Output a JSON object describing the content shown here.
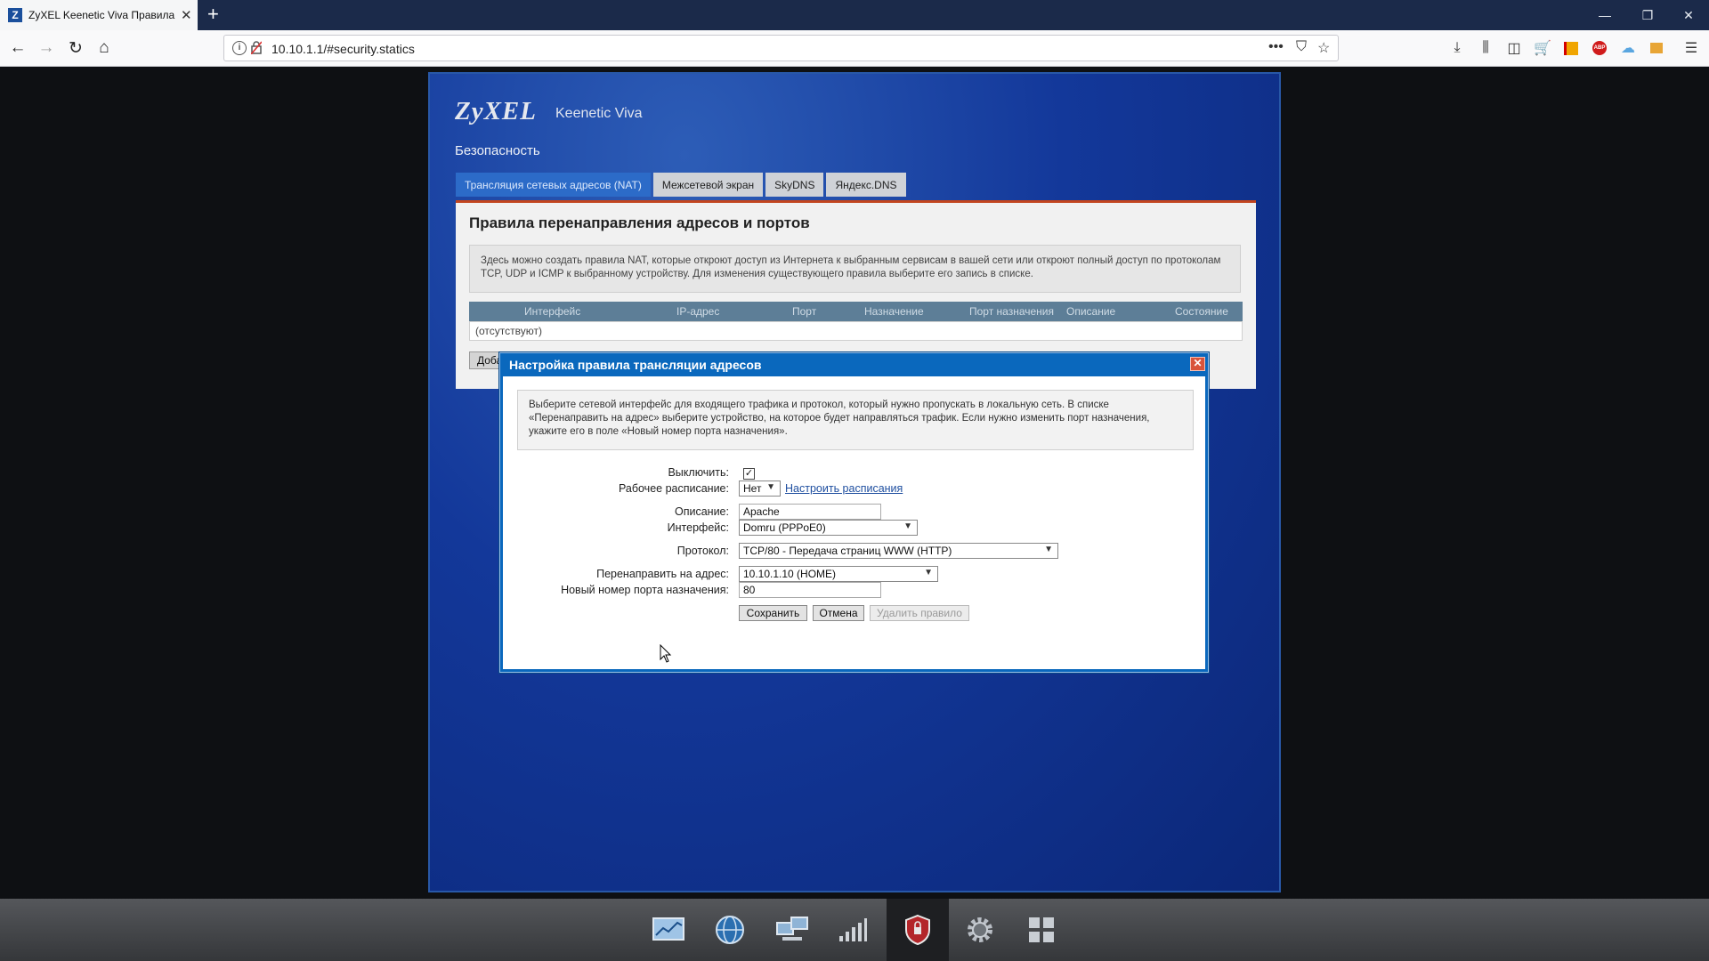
{
  "browser": {
    "tab_title": "ZyXEL Keenetic Viva Правила п",
    "favicon_letter": "Z",
    "url": "10.10.1.1/#security.statics"
  },
  "router": {
    "logo": "ZyXEL",
    "model": "Keenetic Viva",
    "section": "Безопасность",
    "tabs": [
      {
        "label": "Трансляция сетевых адресов (NAT)",
        "active": true
      },
      {
        "label": "Межсетевой экран",
        "active": false
      },
      {
        "label": "SkyDNS",
        "active": false
      },
      {
        "label": "Яндекс.DNS",
        "active": false
      }
    ],
    "panel_title": "Правила перенаправления адресов и портов",
    "panel_info": "Здесь можно создать правила NAT, которые откроют доступ из Интернета к выбранным сервисам в вашей сети или откроют полный доступ по протоколам TCP, UDP и ICMP к выбранному устройству. Для изменения существующего правила выберите его запись в списке.",
    "table_headers": [
      "Интерфейс",
      "IP-адрес",
      "Порт",
      "Назначение",
      "Порт назначения",
      "Описание",
      "Состояние"
    ],
    "table_empty": "(отсутствуют)",
    "add_button": "Добавить правило"
  },
  "dialog": {
    "title": "Настройка правила трансляции адресов",
    "info": "Выберите сетевой интерфейс для входящего трафика и протокол, который нужно пропускать в локальную сеть. В списке «Перенаправить на адрес» выберите устройство, на которое будет направляться трафик. Если нужно изменить порт назначения, укажите его в поле «Новый номер порта назначения».",
    "disable_label": "Выключить:",
    "disable_checked": true,
    "schedule_label": "Рабочее расписание:",
    "schedule_value": "Нет",
    "schedule_link": "Настроить расписания",
    "description_label": "Описание:",
    "description_value": "Apache",
    "interface_label": "Интерфейс:",
    "interface_value": "Domru (PPPoE0)",
    "protocol_label": "Протокол:",
    "protocol_value": "TCP/80 - Передача страниц WWW (HTTP)",
    "redirect_label": "Перенаправить на адрес:",
    "redirect_value": "10.10.1.10 (HOME)",
    "new_port_label": "Новый номер порта назначения:",
    "new_port_value": "80",
    "save_button": "Сохранить",
    "cancel_button": "Отмена",
    "delete_button": "Удалить правило"
  },
  "dock": {
    "icons": [
      "monitor-chart-icon",
      "internet-globe-icon",
      "home-network-icon",
      "wifi-signal-icon",
      "security-shield-icon",
      "settings-gear-icon",
      "apps-grid-icon"
    ],
    "active": "security-shield-icon"
  }
}
